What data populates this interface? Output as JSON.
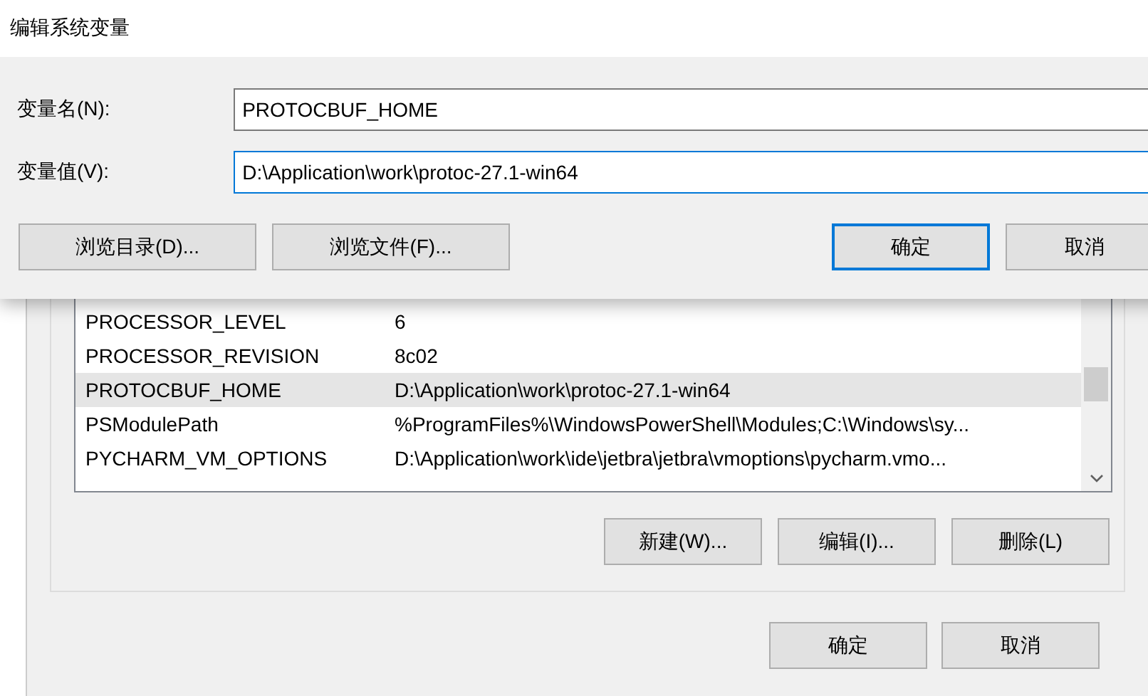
{
  "background_window": {
    "variables": [
      {
        "name": "PROCESSOR_LEVEL",
        "value": "6",
        "selected": false
      },
      {
        "name": "PROCESSOR_REVISION",
        "value": "8c02",
        "selected": false
      },
      {
        "name": "PROTOCBUF_HOME",
        "value": "D:\\Application\\work\\protoc-27.1-win64",
        "selected": true
      },
      {
        "name": "PSModulePath",
        "value": "%ProgramFiles%\\WindowsPowerShell\\Modules;C:\\Windows\\sy...",
        "selected": false
      },
      {
        "name": "PYCHARM_VM_OPTIONS",
        "value": "D:\\Application\\work\\ide\\jetbra\\jetbra\\vmoptions\\pycharm.vmo...",
        "selected": false
      }
    ],
    "list_buttons": [
      {
        "label": "新建(W)..."
      },
      {
        "label": "编辑(I)..."
      },
      {
        "label": "删除(L)"
      }
    ],
    "buttons": [
      {
        "label": "确定"
      },
      {
        "label": "取消"
      }
    ]
  },
  "dialog": {
    "title": "编辑系统变量",
    "fields": [
      {
        "label": "变量名(N):",
        "value": "PROTOCBUF_HOME",
        "focused": false
      },
      {
        "label": "变量值(V):",
        "value": "D:\\Application\\work\\protoc-27.1-win64",
        "focused": true
      }
    ],
    "left_buttons": [
      {
        "label": "浏览目录(D)...",
        "default": false
      },
      {
        "label": "浏览文件(F)...",
        "default": false
      }
    ],
    "right_buttons": [
      {
        "label": "确定",
        "default": true
      },
      {
        "label": "取消",
        "default": false
      }
    ]
  }
}
